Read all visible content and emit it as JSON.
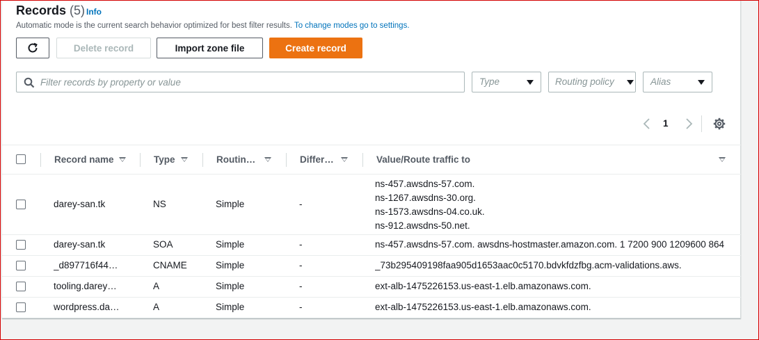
{
  "header": {
    "title": "Records",
    "count": "(5)",
    "info": "Info",
    "description": "Automatic mode is the current search behavior optimized for best filter results.",
    "settings_link": "To change modes go to settings."
  },
  "toolbar": {
    "refresh_icon": "refresh-icon",
    "delete_label": "Delete record",
    "import_label": "Import zone file",
    "create_label": "Create record"
  },
  "filters": {
    "search_placeholder": "Filter records by property or value",
    "type_label": "Type",
    "routing_label": "Routing policy",
    "alias_label": "Alias"
  },
  "pagination": {
    "current_page": "1"
  },
  "colors": {
    "accent": "#ec7211",
    "link": "#0073bb"
  },
  "table": {
    "columns": [
      "Record name",
      "Type",
      "Routin…",
      "Differ…",
      "Value/Route traffic to"
    ],
    "rows": [
      {
        "name": "darey-san.tk",
        "type": "NS",
        "routing": "Simple",
        "differ": "-",
        "values": [
          "ns-457.awsdns-57.com.",
          "ns-1267.awsdns-30.org.",
          "ns-1573.awsdns-04.co.uk.",
          "ns-912.awsdns-50.net."
        ]
      },
      {
        "name": "darey-san.tk",
        "type": "SOA",
        "routing": "Simple",
        "differ": "-",
        "values": [
          "ns-457.awsdns-57.com. awsdns-hostmaster.amazon.com. 1 7200 900 1209600 864"
        ]
      },
      {
        "name": "_d897716f44…",
        "type": "CNAME",
        "routing": "Simple",
        "differ": "-",
        "values": [
          "_73b295409198faa905d1653aac0c5170.bdvkfdzfbg.acm-validations.aws."
        ]
      },
      {
        "name": "tooling.darey…",
        "type": "A",
        "routing": "Simple",
        "differ": "-",
        "values": [
          "ext-alb-1475226153.us-east-1.elb.amazonaws.com."
        ]
      },
      {
        "name": "wordpress.da…",
        "type": "A",
        "routing": "Simple",
        "differ": "-",
        "values": [
          "ext-alb-1475226153.us-east-1.elb.amazonaws.com."
        ]
      }
    ]
  }
}
